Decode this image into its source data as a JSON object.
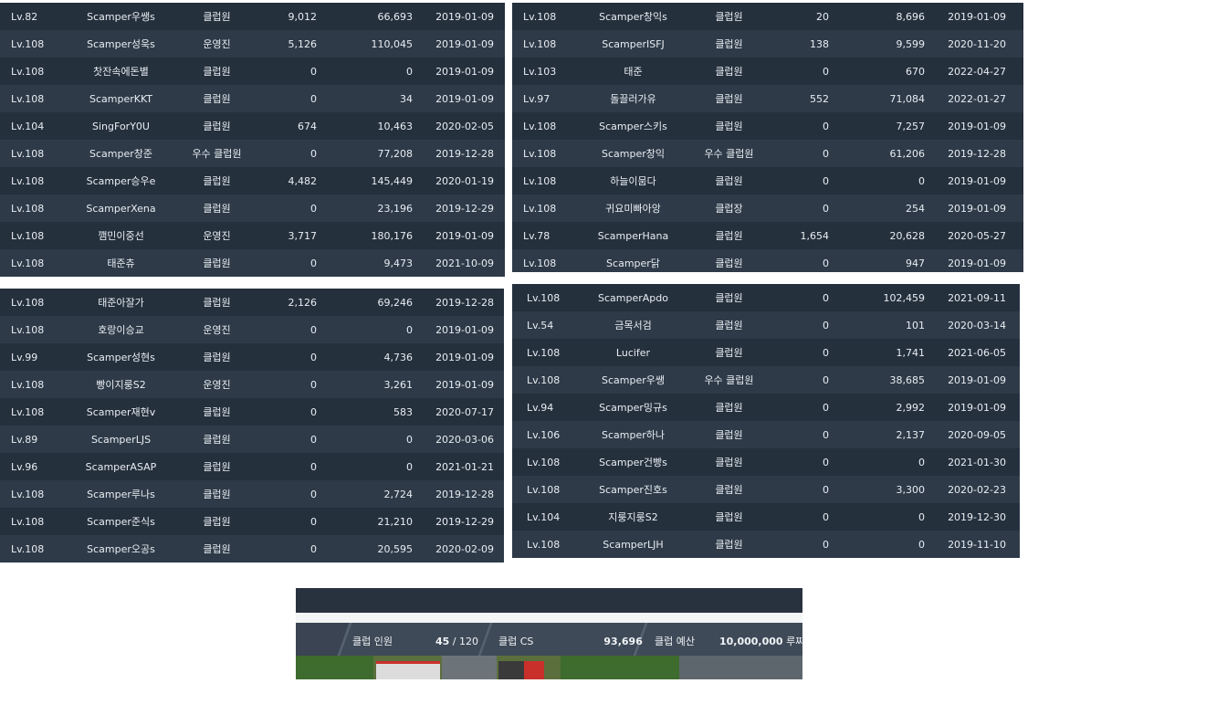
{
  "panels": [
    {
      "rows": [
        {
          "level": "Lv.82",
          "name": "Scamper우쌩s",
          "role": "클럽원",
          "cs": "9,012",
          "total": "66,693",
          "date": "2019-01-09"
        },
        {
          "level": "Lv.108",
          "name": "Scamper성욱s",
          "role": "운영진",
          "cs": "5,126",
          "total": "110,045",
          "date": "2019-01-09"
        },
        {
          "level": "Lv.108",
          "name": "찻잔속에돈별",
          "role": "클럽원",
          "cs": "0",
          "total": "0",
          "date": "2019-01-09"
        },
        {
          "level": "Lv.108",
          "name": "ScamperKKT",
          "role": "클럽원",
          "cs": "0",
          "total": "34",
          "date": "2019-01-09"
        },
        {
          "level": "Lv.104",
          "name": "SingForY0U",
          "role": "클럽원",
          "cs": "674",
          "total": "10,463",
          "date": "2020-02-05"
        },
        {
          "level": "Lv.108",
          "name": "Scamper창준",
          "role": "우수 클럽원",
          "cs": "0",
          "total": "77,208",
          "date": "2019-12-28"
        },
        {
          "level": "Lv.108",
          "name": "Scamper승우e",
          "role": "클럽원",
          "cs": "4,482",
          "total": "145,449",
          "date": "2020-01-19"
        },
        {
          "level": "Lv.108",
          "name": "ScamperXena",
          "role": "클럽원",
          "cs": "0",
          "total": "23,196",
          "date": "2019-12-29"
        },
        {
          "level": "Lv.108",
          "name": "깸민이중선",
          "role": "운영진",
          "cs": "3,717",
          "total": "180,176",
          "date": "2019-01-09"
        },
        {
          "level": "Lv.108",
          "name": "태준츄",
          "role": "클럽원",
          "cs": "0",
          "total": "9,473",
          "date": "2021-10-09"
        }
      ]
    },
    {
      "rows": [
        {
          "level": "Lv.108",
          "name": "Scamper창익s",
          "role": "클럽원",
          "cs": "20",
          "total": "8,696",
          "date": "2019-01-09"
        },
        {
          "level": "Lv.108",
          "name": "ScamperISFJ",
          "role": "클럽원",
          "cs": "138",
          "total": "9,599",
          "date": "2020-11-20"
        },
        {
          "level": "Lv.103",
          "name": "태준",
          "role": "클럽원",
          "cs": "0",
          "total": "670",
          "date": "2022-04-27"
        },
        {
          "level": "Lv.97",
          "name": "돌끌러가유",
          "role": "클럽원",
          "cs": "552",
          "total": "71,084",
          "date": "2022-01-27"
        },
        {
          "level": "Lv.108",
          "name": "Scamper스키s",
          "role": "클럽원",
          "cs": "0",
          "total": "7,257",
          "date": "2019-01-09"
        },
        {
          "level": "Lv.108",
          "name": "Scamper창익",
          "role": "우수 클럽원",
          "cs": "0",
          "total": "61,206",
          "date": "2019-12-28"
        },
        {
          "level": "Lv.108",
          "name": "하늘이뭄다",
          "role": "클럽원",
          "cs": "0",
          "total": "0",
          "date": "2019-01-09"
        },
        {
          "level": "Lv.108",
          "name": "귀요미빠아앙",
          "role": "클럽장",
          "cs": "0",
          "total": "254",
          "date": "2019-01-09"
        },
        {
          "level": "Lv.78",
          "name": "ScamperHana",
          "role": "클럽원",
          "cs": "1,654",
          "total": "20,628",
          "date": "2020-05-27"
        },
        {
          "level": "Lv.108",
          "name": "Scamper닭",
          "role": "클럽원",
          "cs": "0",
          "total": "947",
          "date": "2019-01-09"
        }
      ]
    },
    {
      "rows": [
        {
          "level": "Lv.108",
          "name": "태준아잘가",
          "role": "클럽원",
          "cs": "2,126",
          "total": "69,246",
          "date": "2019-12-28"
        },
        {
          "level": "Lv.108",
          "name": "호랑이승교",
          "role": "운영진",
          "cs": "0",
          "total": "0",
          "date": "2019-01-09"
        },
        {
          "level": "Lv.99",
          "name": "Scamper성현s",
          "role": "클럽원",
          "cs": "0",
          "total": "4,736",
          "date": "2019-01-09"
        },
        {
          "level": "Lv.108",
          "name": "빵이지룽S2",
          "role": "운영진",
          "cs": "0",
          "total": "3,261",
          "date": "2019-01-09"
        },
        {
          "level": "Lv.108",
          "name": "Scamper재현v",
          "role": "클럽원",
          "cs": "0",
          "total": "583",
          "date": "2020-07-17"
        },
        {
          "level": "Lv.89",
          "name": "ScamperLJS",
          "role": "클럽원",
          "cs": "0",
          "total": "0",
          "date": "2020-03-06"
        },
        {
          "level": "Lv.96",
          "name": "ScamperASAP",
          "role": "클럽원",
          "cs": "0",
          "total": "0",
          "date": "2021-01-21"
        },
        {
          "level": "Lv.108",
          "name": "Scamper루나s",
          "role": "클럽원",
          "cs": "0",
          "total": "2,724",
          "date": "2019-12-28"
        },
        {
          "level": "Lv.108",
          "name": "Scamper준식s",
          "role": "클럽원",
          "cs": "0",
          "total": "21,210",
          "date": "2019-12-29"
        },
        {
          "level": "Lv.108",
          "name": "Scamper오공s",
          "role": "클럽원",
          "cs": "0",
          "total": "20,595",
          "date": "2020-02-09"
        }
      ]
    },
    {
      "rows": [
        {
          "level": "Lv.108",
          "name": "ScamperApdo",
          "role": "클럽원",
          "cs": "0",
          "total": "102,459",
          "date": "2021-09-11"
        },
        {
          "level": "Lv.54",
          "name": "금목서검",
          "role": "클럽원",
          "cs": "0",
          "total": "101",
          "date": "2020-03-14"
        },
        {
          "level": "Lv.108",
          "name": "Lucifer",
          "role": "클럽원",
          "cs": "0",
          "total": "1,741",
          "date": "2021-06-05"
        },
        {
          "level": "Lv.108",
          "name": "Scamper우쌩",
          "role": "우수 클럽원",
          "cs": "0",
          "total": "38,685",
          "date": "2019-01-09"
        },
        {
          "level": "Lv.94",
          "name": "Scamper밍규s",
          "role": "클럽원",
          "cs": "0",
          "total": "2,992",
          "date": "2019-01-09"
        },
        {
          "level": "Lv.106",
          "name": "Scamper하나",
          "role": "클럽원",
          "cs": "0",
          "total": "2,137",
          "date": "2020-09-05"
        },
        {
          "level": "Lv.108",
          "name": "Scamper건빵s",
          "role": "클럽원",
          "cs": "0",
          "total": "0",
          "date": "2021-01-30"
        },
        {
          "level": "Lv.108",
          "name": "Scamper진호s",
          "role": "클럽원",
          "cs": "0",
          "total": "3,300",
          "date": "2020-02-23"
        },
        {
          "level": "Lv.104",
          "name": "지룽지룽S2",
          "role": "클럽원",
          "cs": "0",
          "total": "0",
          "date": "2019-12-30"
        },
        {
          "level": "Lv.108",
          "name": "ScamperLJH",
          "role": "클럽원",
          "cs": "0",
          "total": "0",
          "date": "2019-11-10"
        }
      ]
    }
  ],
  "club_bar": {
    "members_label": "클럽 인원",
    "members_count": "45",
    "members_sep": "/",
    "members_max": "120",
    "cs_label": "클럽 CS",
    "cs_value": "93,696",
    "budget_label": "클럽 예산",
    "budget_value": "10,000,000",
    "budget_unit": "루찌"
  },
  "colors": {
    "row_dark": "#25303d",
    "row_light": "#2e3a48",
    "text": "#e8edf2"
  }
}
